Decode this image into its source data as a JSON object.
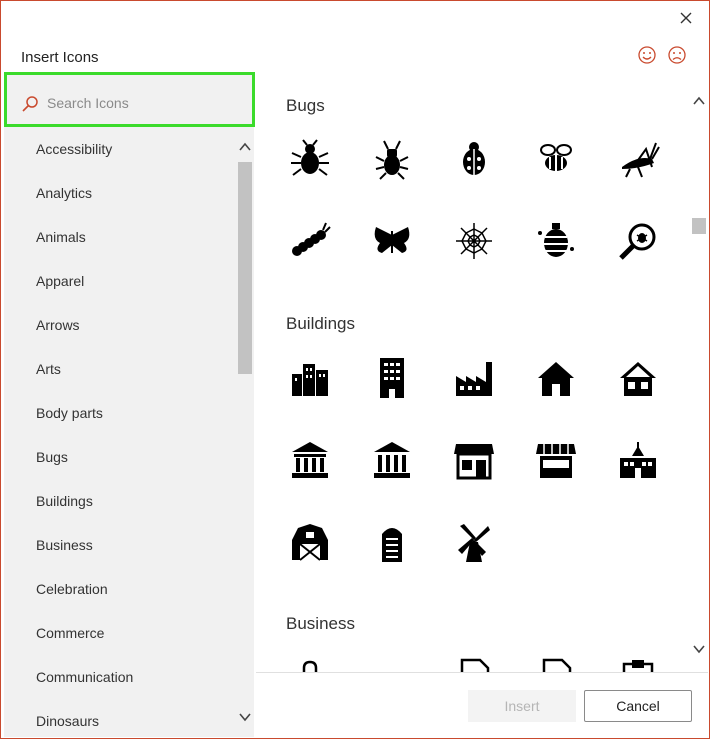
{
  "dialog": {
    "title": "Insert Icons",
    "close_icon": "close-icon",
    "feedback_icons": [
      "smile-icon",
      "frown-icon"
    ],
    "accent": "#c94a2e"
  },
  "search": {
    "placeholder": "Search Icons",
    "value": "",
    "highlight": "#3bdb2b"
  },
  "categories": [
    "Accessibility",
    "Analytics",
    "Animals",
    "Apparel",
    "Arrows",
    "Arts",
    "Body parts",
    "Bugs",
    "Buildings",
    "Business",
    "Celebration",
    "Commerce",
    "Communication",
    "Dinosaurs"
  ],
  "sections": [
    {
      "title": "Bugs",
      "icons": [
        "beetle-icon",
        "stag-beetle-icon",
        "ladybug-icon",
        "bee-icon",
        "grasshopper-icon",
        "caterpillar-icon",
        "butterfly-icon",
        "spider-web-icon",
        "beehive-icon",
        "bug-magnifier-icon"
      ]
    },
    {
      "title": "Buildings",
      "icons": [
        "city-icon",
        "office-building-icon",
        "factory-icon",
        "house-icon",
        "home-icon",
        "bank-icon",
        "courthouse-icon",
        "storefront-icon",
        "market-stall-icon",
        "school-icon",
        "barn-icon",
        "silo-icon",
        "windmill-icon"
      ]
    },
    {
      "title": "Business",
      "icons": [
        "paperclip-icon",
        "folder-icon",
        "document-icon",
        "document-icon",
        "clipboard-icon"
      ]
    }
  ],
  "buttons": {
    "insert": "Insert",
    "cancel": "Cancel"
  }
}
